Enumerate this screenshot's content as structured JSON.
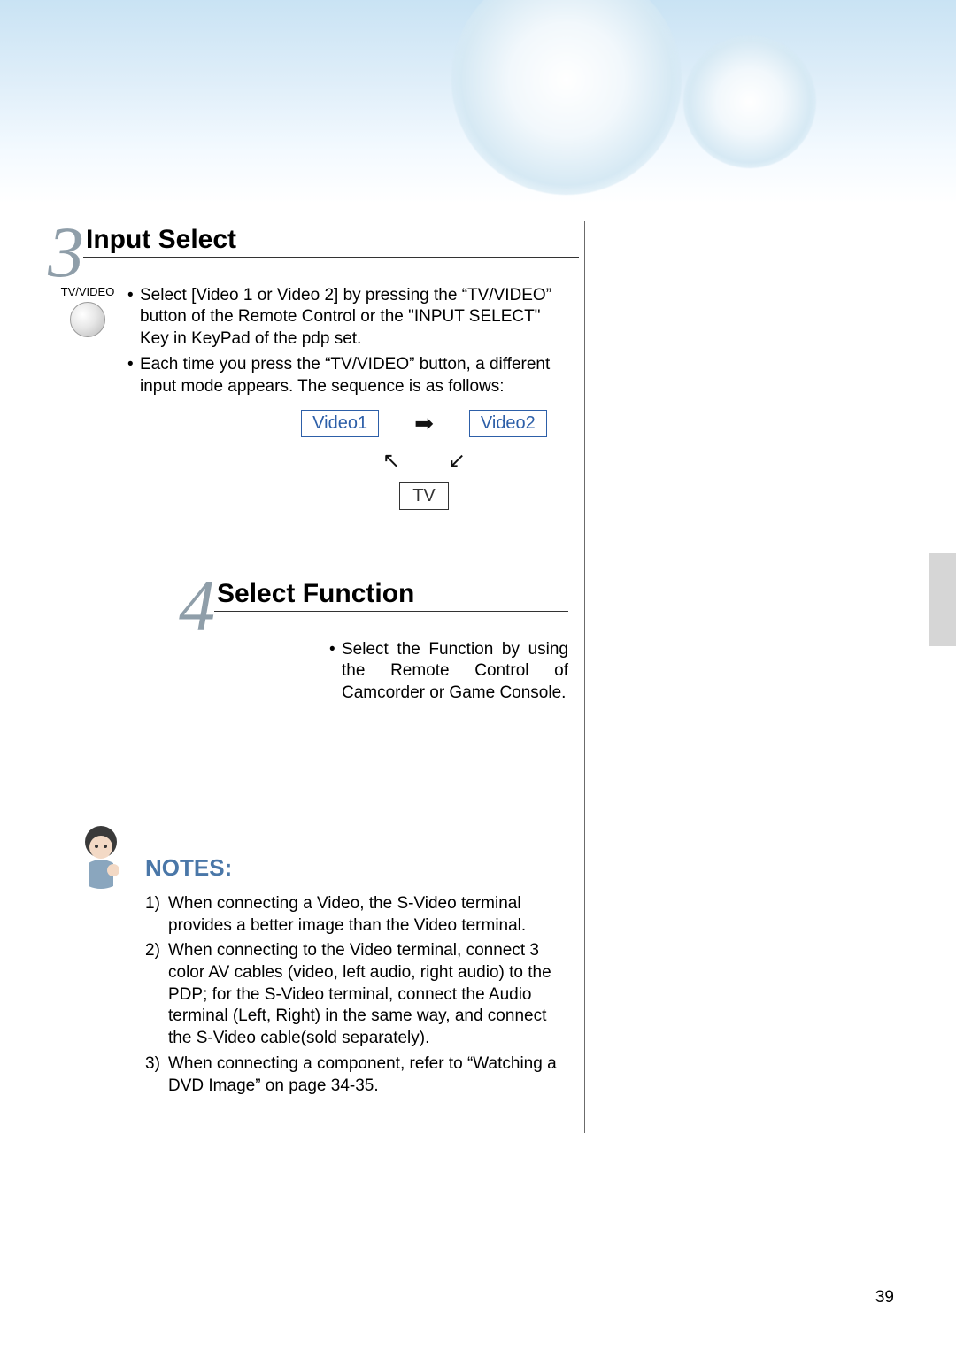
{
  "section3": {
    "number": "3",
    "title": "Input Select",
    "button_label": "TV/VIDEO",
    "bullet1": "Select [Video 1 or Video 2] by pressing the “TV/VIDEO” button of the Remote Control or the \"INPUT SELECT\" Key in KeyPad of the pdp set.",
    "bullet2": "Each time you press the “TV/VIDEO” button, a different input mode appears. The sequence is as follows:",
    "seq": {
      "v1": "Video1",
      "v2": "Video2",
      "tv": "TV"
    }
  },
  "section4": {
    "number": "4",
    "title": "Select Function",
    "bullet1": "Select the Function by using the Remote Control of Camcorder or Game Console."
  },
  "notes": {
    "heading": "NOTES:",
    "items": [
      {
        "n": "1)",
        "t": "When connecting a Video, the S-Video terminal provides a better image than the Video terminal."
      },
      {
        "n": "2)",
        "t": "When connecting to the Video terminal, connect 3 color AV cables (video, left audio, right audio) to the PDP; for the S-Video terminal, connect the Audio terminal (Left, Right) in the same way, and connect the S-Video cable(sold separately)."
      },
      {
        "n": "3)",
        "t": "When connecting a component, refer to “Watching a DVD Image” on page 34-35."
      }
    ]
  },
  "page_number": "39"
}
